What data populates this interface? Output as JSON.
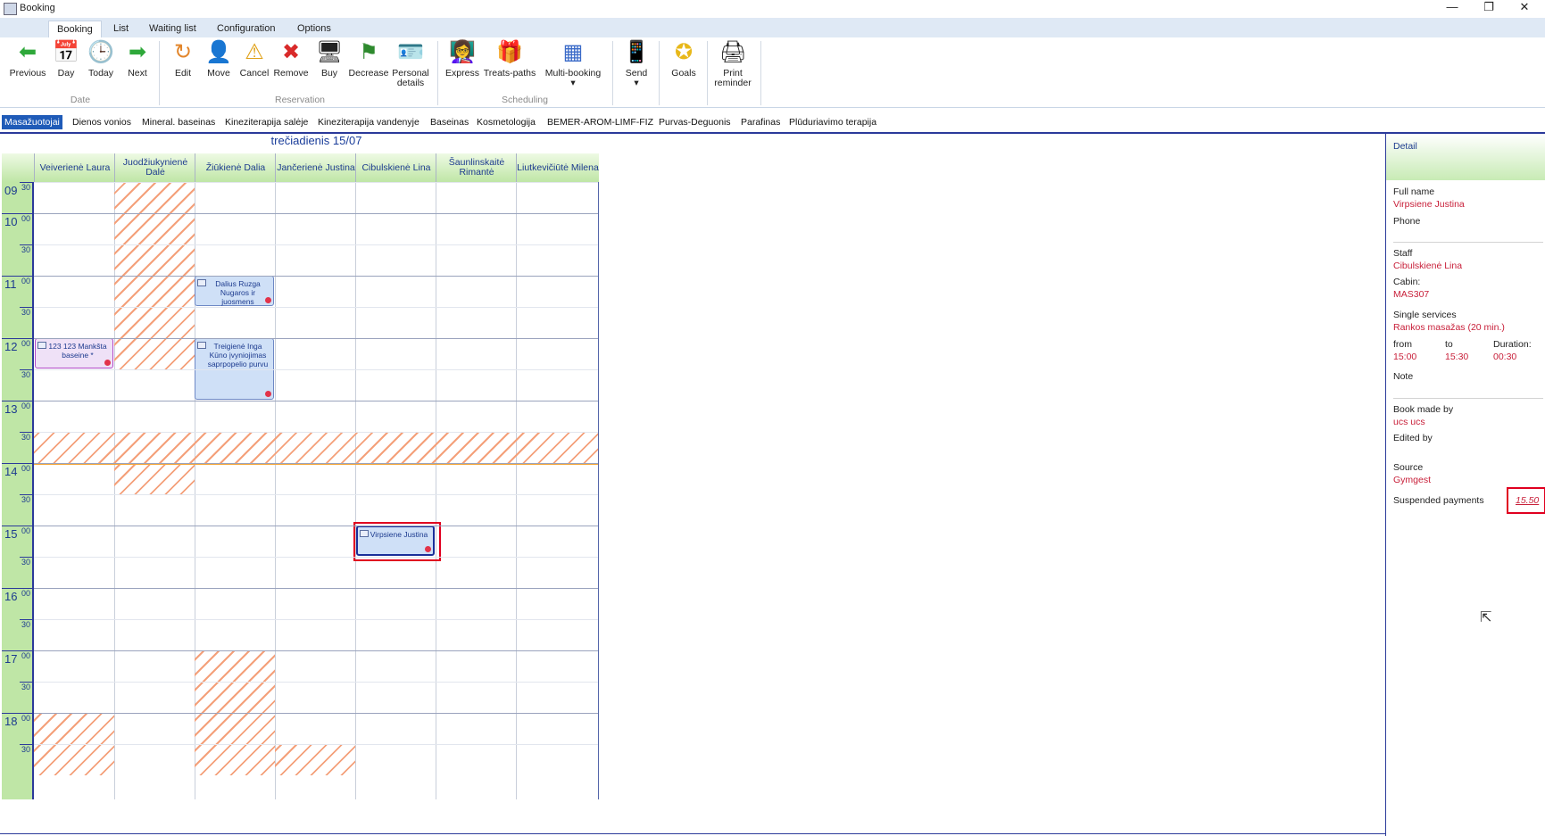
{
  "window": {
    "title": "Booking",
    "minimize": "—",
    "restore": "❐",
    "close": "✕"
  },
  "ribbon_tabs": [
    "Booking",
    "List",
    "Waiting list",
    "Configuration",
    "Options"
  ],
  "ribbon": {
    "buttons": [
      {
        "label": "Previous",
        "icon": "arrow-left-icon",
        "glyph": "⬅",
        "color": "#2ea83a"
      },
      {
        "label": "Day",
        "icon": "calendar-day-icon",
        "glyph": "📅",
        "color": "#c77b2a"
      },
      {
        "label": "Today",
        "icon": "clock-icon",
        "glyph": "🕒",
        "color": "#2a7a2a"
      },
      {
        "label": "Next",
        "icon": "arrow-right-icon",
        "glyph": "➡",
        "color": "#2ea83a"
      },
      {
        "label": "Edit",
        "icon": "edit-arrow-icon",
        "glyph": "↻",
        "color": "#e2852a"
      },
      {
        "label": "Move",
        "icon": "person-icon",
        "glyph": "👤",
        "color": "#d9582a"
      },
      {
        "label": "Cancel",
        "icon": "warning-icon",
        "glyph": "⚠",
        "color": "#e0a21a"
      },
      {
        "label": "Remove",
        "icon": "close-red-icon",
        "glyph": "✖",
        "color": "#d92a2a"
      },
      {
        "label": "Buy",
        "icon": "monitor-icon",
        "glyph": "🖥",
        "color": "#3a5a8a"
      },
      {
        "label": "Decrease",
        "icon": "flag-icon",
        "glyph": "⚑",
        "color": "#2e8a2e"
      },
      {
        "label": "Personal details",
        "icon": "id-card-icon",
        "glyph": "🪪",
        "color": "#3a6ac8"
      },
      {
        "label": "Express",
        "icon": "presenter-icon",
        "glyph": "👩‍🏫",
        "color": "#3a6ac8"
      },
      {
        "label": "Treats-paths",
        "icon": "gift-icon",
        "glyph": "🎁",
        "color": "#c83aa8"
      },
      {
        "label": "Multi-booking",
        "icon": "calendar-grid-icon",
        "glyph": "▦",
        "color": "#3a6ac8"
      },
      {
        "label": "Send",
        "icon": "phone-icon",
        "glyph": "📱",
        "color": "#556677"
      },
      {
        "label": "Goals",
        "icon": "gold-coin-icon",
        "glyph": "✪",
        "color": "#e8b81a"
      },
      {
        "label": "Print reminder",
        "icon": "printer-icon",
        "glyph": "🖨",
        "color": "#556677"
      }
    ],
    "groups": [
      "Date",
      "Reservation",
      "Scheduling"
    ]
  },
  "services": [
    "Masažuotojai",
    "Dienos vonios",
    "Mineral. baseinas",
    "Kineziterapija salėje",
    "Kineziterapija vandenyje",
    "Baseinas",
    "Kosmetologija",
    "BEMER-AROM-LIMF-FIZ",
    "Purvas-Deguonis",
    "Parafinas",
    "Plūduriavimo terapija"
  ],
  "calendar": {
    "day_title": "trečiadienis 15/07",
    "staff": [
      "Veiverienė Laura",
      "Juodžiukynienė Dalė",
      "Žiūkienė Dalia",
      "Jančerienė Justina",
      "Cibulskienė Lina",
      "Šaunlinskaitė Rimantė",
      "Liutkevičiūtė Milena"
    ],
    "hours": [
      "09",
      "10",
      "11",
      "12",
      "13",
      "14",
      "15",
      "16",
      "17",
      "18"
    ],
    "minute_marks": [
      "00",
      "30"
    ],
    "appointments": [
      {
        "text": "Dalius Ruzga Nugaros ir juosmens"
      },
      {
        "text": "123 123 Mankšta baseine *"
      },
      {
        "text": "Treigienė Inga Kūno įvyniojimas saprpopelio purvu"
      },
      {
        "text": "Virpsiene Justina"
      }
    ]
  },
  "detail": {
    "header": "Detail",
    "full_name_label": "Full name",
    "full_name": "Virpsiene Justina",
    "phone_label": "Phone",
    "staff_label": "Staff",
    "staff": "Cibulskienė Lina",
    "cabin_label": "Cabin:",
    "cabin": "MAS307",
    "single_services_label": "Single services",
    "single_services": "Rankos masažas (20 min.)",
    "from_label": "from",
    "from": "15:00",
    "to_label": "to",
    "to": "15:30",
    "duration_label": "Duration:",
    "duration": "00:30",
    "note_label": "Note",
    "book_made_by_label": "Book made by",
    "book_made_by": "ucs ucs",
    "edited_by_label": "Edited by",
    "source_label": "Source",
    "source": "Gymgest",
    "suspended_payments_label": "Suspended payments",
    "suspended_payments": "15.50"
  },
  "colors": {
    "accent": "#1f5bb8",
    "header_green": "#bfe6a6",
    "highlight_red": "#e00020",
    "hatch": "#f4a07a",
    "now_line": "#f5a83a"
  }
}
